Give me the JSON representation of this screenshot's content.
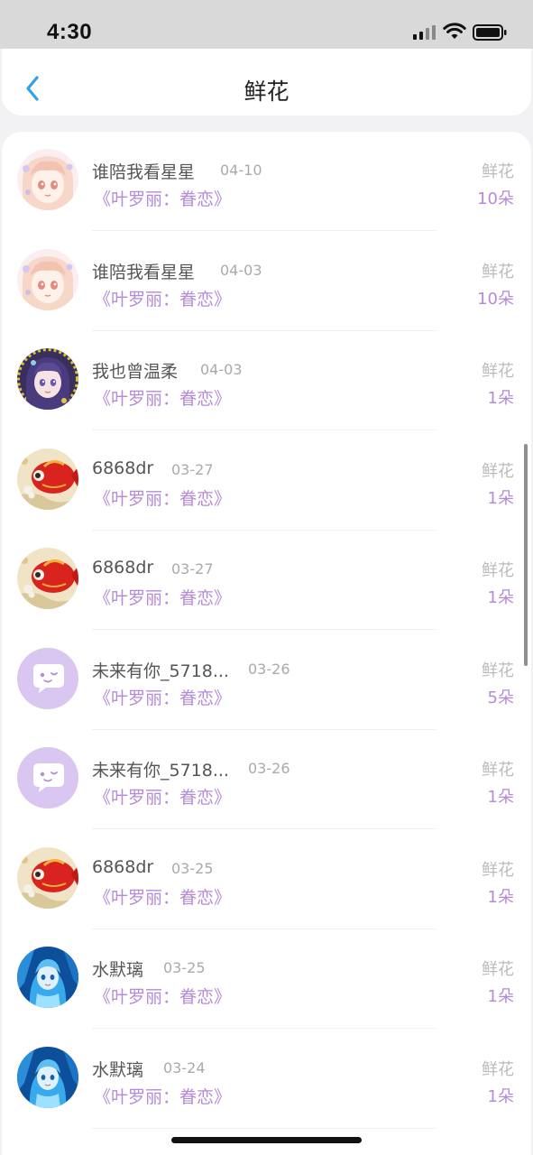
{
  "status_bar": {
    "time": "4:30"
  },
  "header": {
    "title": "鲜花",
    "back_icon": "chevron-left-icon"
  },
  "colors": {
    "accent": "#b58ad6",
    "link_blue": "#2ea1e8"
  },
  "records": [
    {
      "name": "谁陪我看星星",
      "date": "04-10",
      "target": "《叶罗丽：眷恋》",
      "gift": "鲜花",
      "count": "10朵",
      "avatar": "anime-girl-pink"
    },
    {
      "name": "谁陪我看星星",
      "date": "04-03",
      "target": "《叶罗丽：眷恋》",
      "gift": "鲜花",
      "count": "10朵",
      "avatar": "anime-girl-pink"
    },
    {
      "name": "我也曾温柔",
      "date": "04-03",
      "target": "《叶罗丽：眷恋》",
      "gift": "鲜花",
      "count": "1朵",
      "avatar": "anime-girl-purple"
    },
    {
      "name": "6868dr",
      "date": "03-27",
      "target": "《叶罗丽：眷恋》",
      "gift": "鲜花",
      "count": "1朵",
      "avatar": "red-koi-fish"
    },
    {
      "name": "6868dr",
      "date": "03-27",
      "target": "《叶罗丽：眷恋》",
      "gift": "鲜花",
      "count": "1朵",
      "avatar": "red-koi-fish"
    },
    {
      "name": "未来有你_5718...",
      "date": "03-26",
      "target": "《叶罗丽：眷恋》",
      "gift": "鲜花",
      "count": "5朵",
      "avatar": "default-chat-bubble"
    },
    {
      "name": "未来有你_5718...",
      "date": "03-26",
      "target": "《叶罗丽：眷恋》",
      "gift": "鲜花",
      "count": "1朵",
      "avatar": "default-chat-bubble"
    },
    {
      "name": "6868dr",
      "date": "03-25",
      "target": "《叶罗丽：眷恋》",
      "gift": "鲜花",
      "count": "1朵",
      "avatar": "red-koi-fish"
    },
    {
      "name": "水默璃",
      "date": "03-25",
      "target": "《叶罗丽：眷恋》",
      "gift": "鲜花",
      "count": "1朵",
      "avatar": "anime-blue-character"
    },
    {
      "name": "水默璃",
      "date": "03-24",
      "target": "《叶罗丽：眷恋》",
      "gift": "鲜花",
      "count": "1朵",
      "avatar": "anime-blue-character"
    }
  ]
}
